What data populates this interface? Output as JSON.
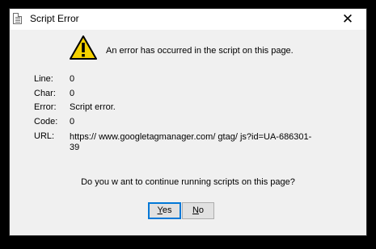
{
  "window": {
    "title": "Script Error",
    "close_glyph": "✕"
  },
  "message": {
    "headline": "An error has occurred in the script on this page.",
    "icon": "warning-icon"
  },
  "details": [
    {
      "label": "Line:",
      "value": "0"
    },
    {
      "label": "Char:",
      "value": "0"
    },
    {
      "label": "Error:",
      "value": "Script error."
    },
    {
      "label": "Code:",
      "value": "0"
    },
    {
      "label": "URL:",
      "value": "https:// www.googletagmanager.com/ gtag/ js?id=UA-686301-39"
    }
  ],
  "question": "Do you w ant to continue running scripts on this page?",
  "buttons": {
    "yes_mnemonic": "Y",
    "yes_rest": "es",
    "no_mnemonic": "N",
    "no_rest": "o"
  },
  "colors": {
    "focus_border": "#0078d7",
    "warning_yellow": "#f5d100"
  }
}
